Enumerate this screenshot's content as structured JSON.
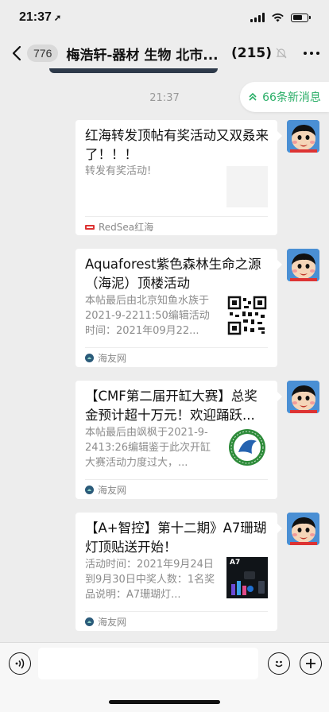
{
  "status": {
    "time": "21:37",
    "location_glyph": "➚"
  },
  "nav": {
    "back_count": "776",
    "title": "梅浩轩-器材 生物 北市...",
    "member_count": "(215)"
  },
  "chat": {
    "timestamp": "21:37",
    "new_messages": "66条新消息"
  },
  "messages": [
    {
      "title": "红海转发顶帖有奖活动又双叒来了！！！",
      "description": "转发有奖活动!",
      "source": "RedSea红海",
      "thumb": "blank"
    },
    {
      "title": "Aquaforest紫色森林生命之源（海泥）顶楼活动",
      "description": "本帖最后由北京知鱼水族于2021-9-2211:50编辑活动时间：2021年09月22...",
      "source": "海友网",
      "thumb": "qr-code"
    },
    {
      "title": "【CMF第二届开缸大赛】总奖金预计超十万元！欢迎踊跃...",
      "description": "本帖最后由飒枫于2021-9-2413:26编辑鉴于此次开缸大赛活动力度过大，...",
      "source": "海友网",
      "thumb": "cmf-logo"
    },
    {
      "title": "【A+智控】第十二期》A7珊瑚灯顶贴送开始！",
      "description": "活动时间：2021年9月24日到9月30日中奖人数：1名奖品说明：A7珊瑚灯...",
      "source": "海友网",
      "thumb": "a7-lamp",
      "thumb_label": "A7"
    }
  ],
  "colors": {
    "accent_green": "#2aae67",
    "background": "#ededed"
  }
}
